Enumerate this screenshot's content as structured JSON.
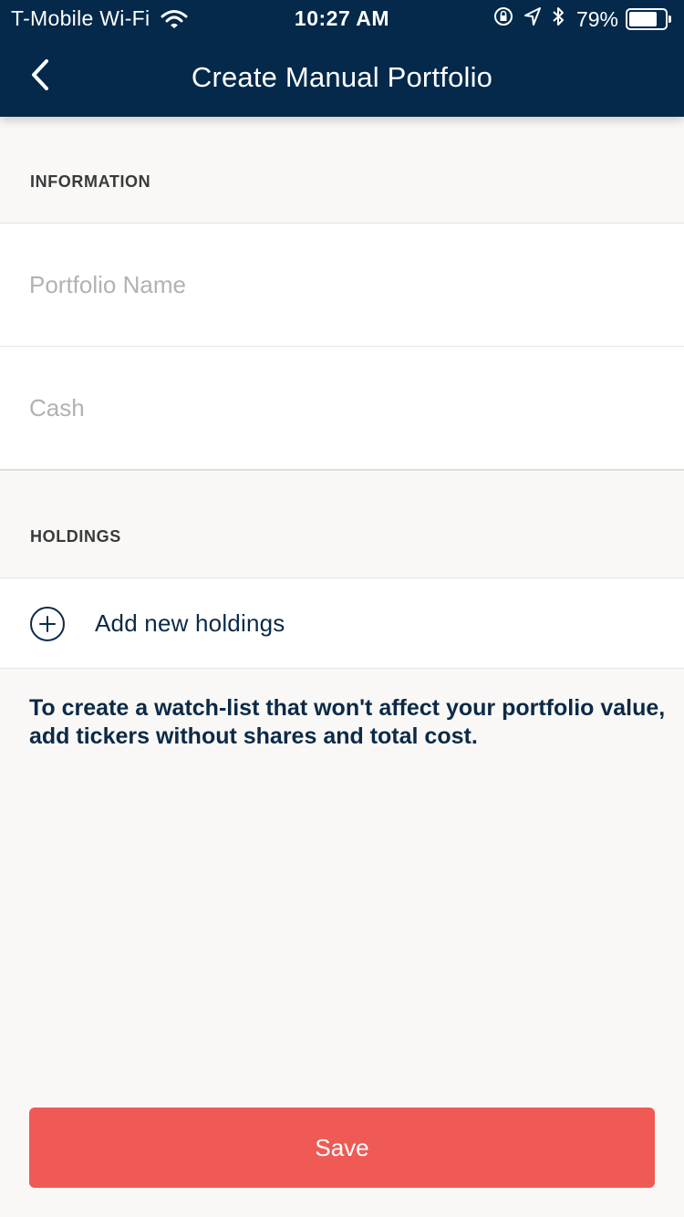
{
  "status_bar": {
    "carrier": "T-Mobile Wi-Fi",
    "time": "10:27 AM",
    "battery_percent": "79%",
    "battery_level": 0.79,
    "icons": [
      "wifi-icon",
      "orientation-lock-icon",
      "location-arrow-icon",
      "bluetooth-icon",
      "battery-icon"
    ]
  },
  "nav": {
    "title": "Create Manual Portfolio",
    "back_icon": "chevron-left-icon"
  },
  "information": {
    "header": "INFORMATION",
    "portfolio_name": {
      "value": "",
      "placeholder": "Portfolio Name"
    },
    "cash": {
      "value": "",
      "placeholder": "Cash"
    }
  },
  "holdings": {
    "header": "HOLDINGS",
    "add_label": "Add new holdings",
    "add_icon": "plus-circle-icon"
  },
  "note": "To create a watch-list that won't affect your portfolio value, add tickers without shares and total cost.",
  "save_label": "Save",
  "colors": {
    "header_bg": "#04294a",
    "accent_button": "#f05a54",
    "page_bg": "#f9f8f6",
    "text_dark": "#0b2a47",
    "placeholder": "#b2b2b2"
  }
}
